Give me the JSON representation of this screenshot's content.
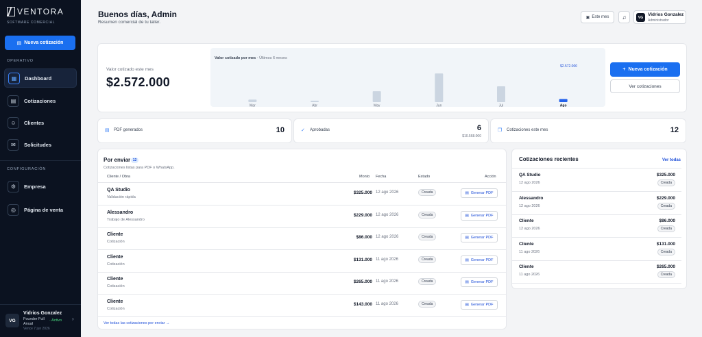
{
  "brand": {
    "name": "VENTORA",
    "subtitle": "SOFTWARE COMERCIAL"
  },
  "sidebar": {
    "new_button": "Nueva cotización",
    "section_operativo": "OPERATIVO",
    "section_config": "CONFIGURACIÓN",
    "items": [
      {
        "label": "Dashboard"
      },
      {
        "label": "Cotizaciones"
      },
      {
        "label": "Clientes"
      },
      {
        "label": "Solicitudes"
      },
      {
        "label": "Empresa"
      },
      {
        "label": "Página de venta"
      }
    ],
    "user": {
      "initials": "VG",
      "name": "Vidrios Gonzalez",
      "plan": "Founder Full Anual",
      "status": "· Activo",
      "expires": "Vence 7 jun 2026"
    }
  },
  "header": {
    "greeting": "Buenos días, Admin",
    "subtitle": "Resumen comercial de tu taller.",
    "period_button": "Este mes",
    "user": {
      "initials": "VG",
      "name": "Vidrios Gonzalez",
      "role": "Administrador"
    }
  },
  "hero": {
    "label": "Valor cotizado este mes",
    "value": "$2.572.000",
    "chart_title": "Valor cotizado por mes",
    "chart_subtitle": "Últimos 6 meses",
    "peak_label": "$2.572.000",
    "primary_button": "Nueva cotización",
    "secondary_button": "Ver cotizaciones"
  },
  "chart_data": {
    "type": "bar",
    "title": "Valor cotizado por mes",
    "subtitle": "Últimos 6 meses",
    "categories": [
      "Mar",
      "Abr",
      "May",
      "Jun",
      "Jul",
      "Ago"
    ],
    "values": [
      0.05,
      0.02,
      0.22,
      0.58,
      0.32,
      0.06
    ],
    "highlight_index": 5,
    "colors": {
      "bar": "#cbd5e1",
      "highlight": "#2563eb"
    }
  },
  "stats": [
    {
      "label": "PDF generados",
      "value": "10",
      "sub": ""
    },
    {
      "label": "Aprobadas",
      "value": "6",
      "sub": "$10.568.000"
    },
    {
      "label": "Cotizaciones este mes",
      "value": "12",
      "sub": ""
    }
  ],
  "pending": {
    "title": "Por enviar",
    "count": "12",
    "subtitle": "Cotizaciones listas para PDF o WhatsApp.",
    "columns": {
      "client": "Cliente / Obra",
      "amount": "Monto",
      "date": "Fecha",
      "status": "Estado",
      "action": "Acción"
    },
    "rows": [
      {
        "name": "QA Studio",
        "desc": "Validación rápida",
        "amount": "$325.000",
        "date": "12 ago 2026",
        "status": "Creada",
        "action": "Generar PDF"
      },
      {
        "name": "Alessandro",
        "desc": "Trabajo de Alessandro",
        "amount": "$229.000",
        "date": "12 ago 2026",
        "status": "Creada",
        "action": "Generar PDF"
      },
      {
        "name": "Cliente",
        "desc": "Cotización",
        "amount": "$86.000",
        "date": "12 ago 2026",
        "status": "Creada",
        "action": "Generar PDF"
      },
      {
        "name": "Cliente",
        "desc": "Cotización",
        "amount": "$131.000",
        "date": "11 ago 2026",
        "status": "Creada",
        "action": "Generar PDF"
      },
      {
        "name": "Cliente",
        "desc": "Cotización",
        "amount": "$265.000",
        "date": "11 ago 2026",
        "status": "Creada",
        "action": "Generar PDF"
      },
      {
        "name": "Cliente",
        "desc": "Cotización",
        "amount": "$143.000",
        "date": "11 ago 2026",
        "status": "Creada",
        "action": "Generar PDF"
      }
    ],
    "footer_link": "Ver todas las cotizaciones por enviar →"
  },
  "recent": {
    "title": "Cotizaciones recientes",
    "link": "Ver todas",
    "rows": [
      {
        "name": "QA Studio",
        "date": "12 ago 2026",
        "amount": "$325.000",
        "status": "Creada"
      },
      {
        "name": "Alessandro",
        "date": "12 ago 2026",
        "amount": "$229.000",
        "status": "Creada"
      },
      {
        "name": "Cliente",
        "date": "12 ago 2026",
        "amount": "$86.000",
        "status": "Creada"
      },
      {
        "name": "Cliente",
        "date": "11 ago 2026",
        "amount": "$131.000",
        "status": "Creada"
      },
      {
        "name": "Cliente",
        "date": "11 ago 2026",
        "amount": "$265.000",
        "status": "Creada"
      }
    ]
  }
}
